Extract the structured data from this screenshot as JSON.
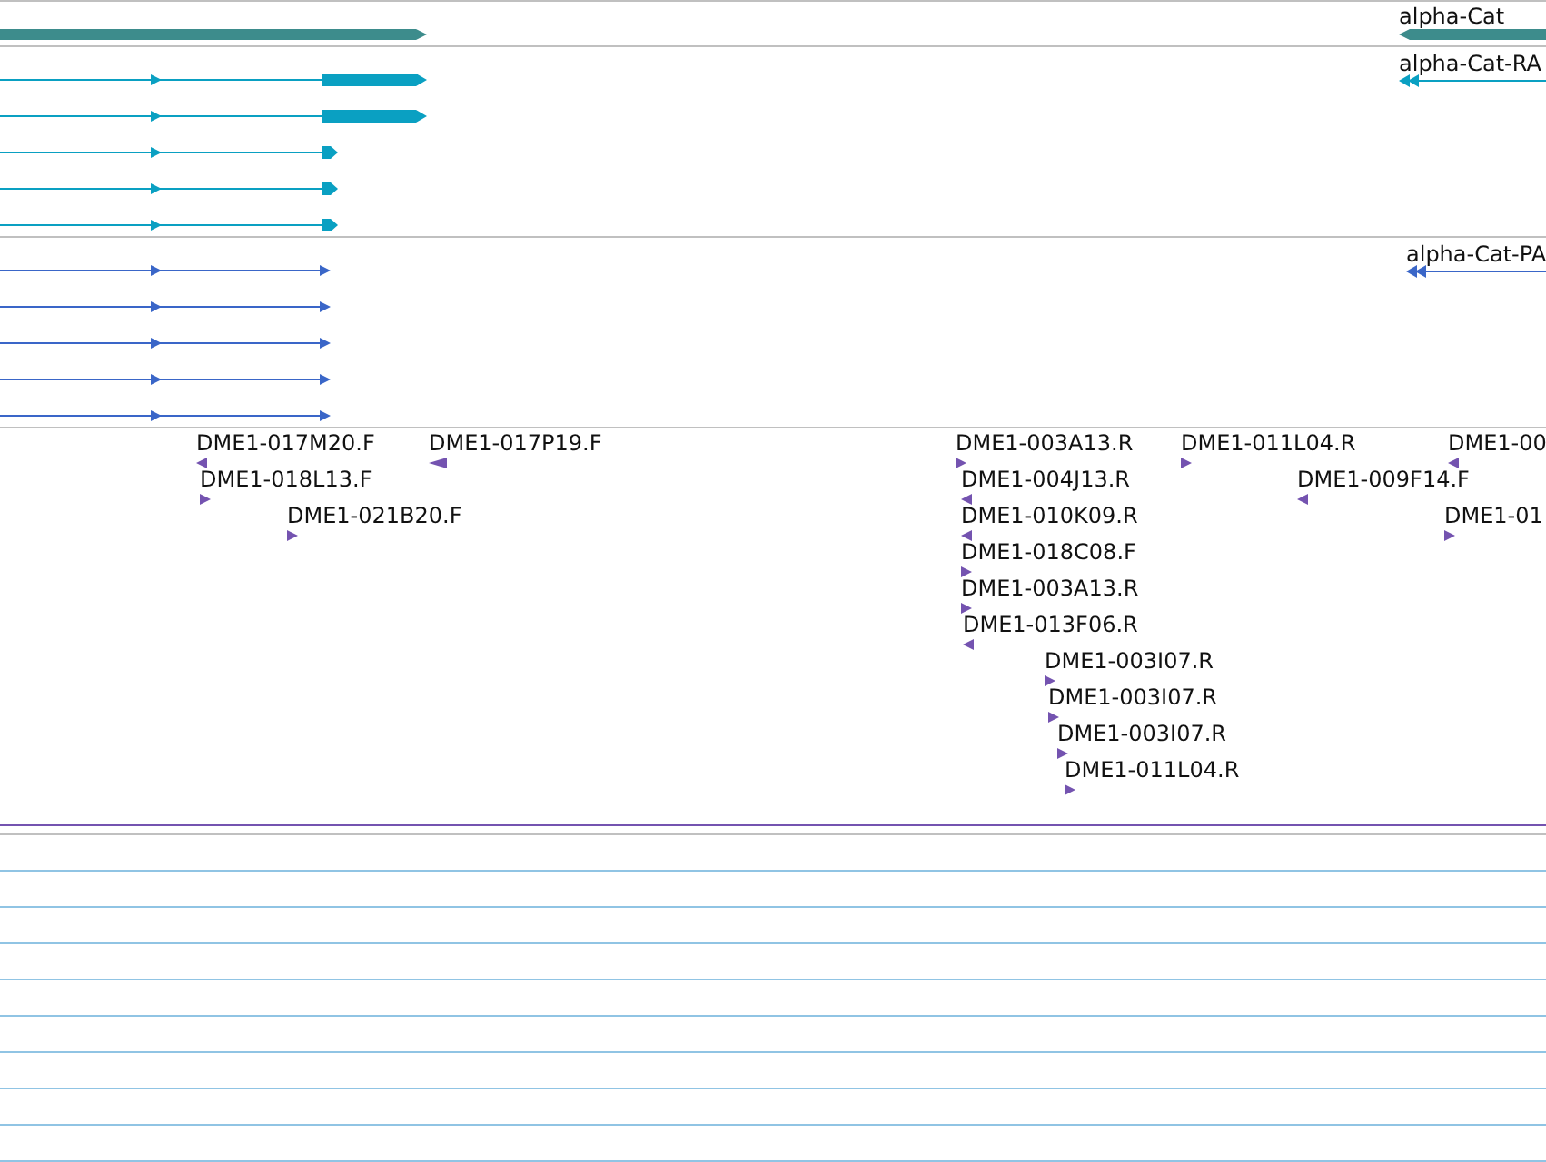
{
  "gene_track": {
    "features": [
      {
        "kind": "forward"
      },
      {
        "label": "alpha-Cat",
        "kind": "reverse"
      }
    ]
  },
  "transcript_tracks": [
    {
      "kind": "cds",
      "transcripts": [
        {
          "kind": "forward"
        },
        {
          "kind": "forward"
        },
        {
          "kind": "forward"
        },
        {
          "kind": "forward"
        },
        {
          "kind": "forward"
        },
        {
          "label": "alpha-Cat-RA",
          "kind": "reverse"
        }
      ]
    },
    {
      "kind": "mrna",
      "transcripts": [
        {
          "kind": "forward"
        },
        {
          "kind": "forward"
        },
        {
          "kind": "forward"
        },
        {
          "kind": "forward"
        },
        {
          "kind": "forward"
        },
        {
          "label": "alpha-Cat-PA",
          "kind": "reverse"
        }
      ]
    }
  ],
  "reads": [
    {
      "label": "DME1-017M20.F",
      "kind": "reverse"
    },
    {
      "label": "DME1-017P19.F",
      "kind": "reverse"
    },
    {
      "label": "DME1-018L13.F",
      "kind": "forward"
    },
    {
      "label": "DME1-021B20.F",
      "kind": "forward"
    },
    {
      "label": "DME1-003A13.R",
      "kind": "forward"
    },
    {
      "label": "DME1-004J13.R",
      "kind": "reverse"
    },
    {
      "label": "DME1-010K09.R",
      "kind": "reverse"
    },
    {
      "label": "DME1-018C08.F",
      "kind": "forward"
    },
    {
      "label": "DME1-003A13.R",
      "kind": "forward"
    },
    {
      "label": "DME1-013F06.R",
      "kind": "reverse"
    },
    {
      "label": "DME1-003I07.R",
      "kind": "forward"
    },
    {
      "label": "DME1-003I07.R",
      "kind": "forward"
    },
    {
      "label": "DME1-003I07.R",
      "kind": "forward"
    },
    {
      "label": "DME1-011L04.R",
      "kind": "forward"
    },
    {
      "label": "DME1-011L04.R",
      "kind": "forward"
    },
    {
      "label": "DME1-009F14.F",
      "kind": "reverse"
    },
    {
      "label": "DME1-00",
      "kind": "reverse"
    },
    {
      "label": "DME1-01",
      "kind": "forward"
    }
  ]
}
